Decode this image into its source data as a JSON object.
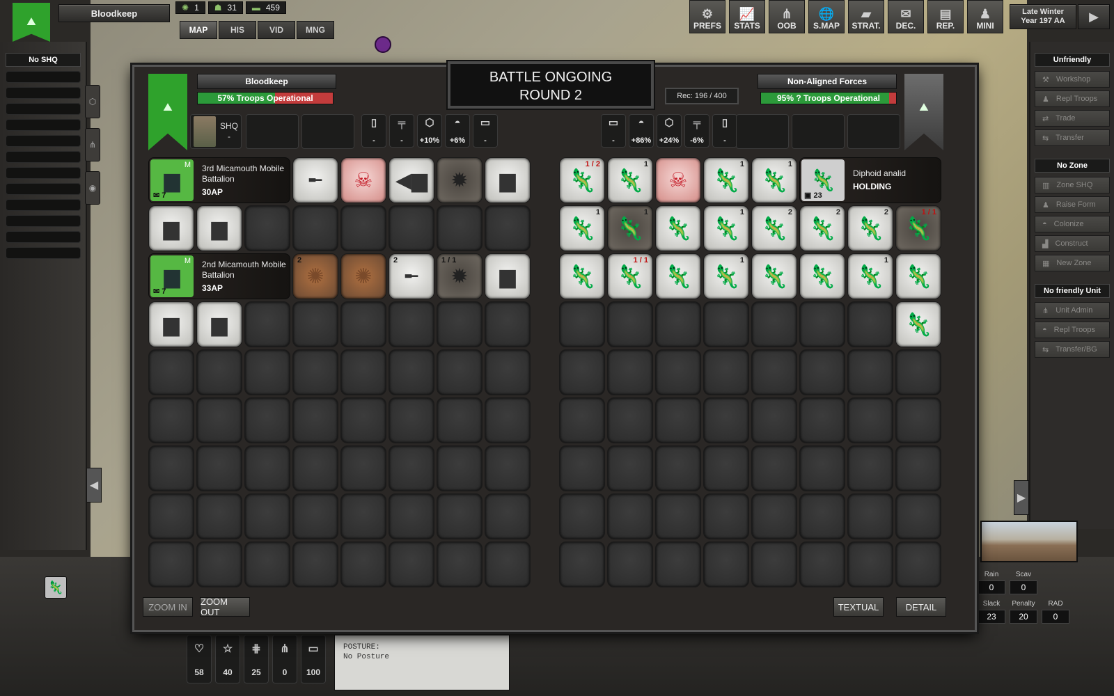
{
  "top": {
    "faction_name": "Bloodkeep",
    "resources": [
      {
        "icon": "sun-icon",
        "value": "1"
      },
      {
        "icon": "troops-icon",
        "value": "31"
      },
      {
        "icon": "money-icon",
        "value": "459"
      }
    ],
    "tabs": [
      "MAP",
      "HIS",
      "VID",
      "MNG"
    ],
    "buttons": [
      {
        "label": "PREFS",
        "icon": "⚙",
        "name": "prefs"
      },
      {
        "label": "STATS",
        "icon": "📈",
        "name": "stats"
      },
      {
        "label": "OOB",
        "icon": "⋔",
        "name": "oob"
      },
      {
        "label": "S.MAP",
        "icon": "🌐",
        "name": "smap"
      },
      {
        "label": "STRAT.",
        "icon": "▰",
        "name": "strat"
      },
      {
        "label": "DEC.",
        "icon": "✉",
        "name": "dec"
      },
      {
        "label": "REP.",
        "icon": "▤",
        "name": "rep"
      },
      {
        "label": "MINI",
        "icon": "♟",
        "name": "mini"
      }
    ],
    "season": "Late Winter",
    "year": "Year 197 AA"
  },
  "left_panel": {
    "header": "No SHQ"
  },
  "battle": {
    "title_line1": "BATTLE ONGOING",
    "title_line2": "ROUND 2",
    "rec": "Rec: 196 / 400",
    "player": {
      "name": "Bloodkeep",
      "operational": "57% Troops Operational",
      "operational_fraction": 0.57,
      "shq_label": "SHQ",
      "shq_value": "-",
      "stats": [
        {
          "icon": "▯",
          "name": "card-icon",
          "value": "-"
        },
        {
          "icon": "╤",
          "name": "pistol-icon",
          "value": "-"
        },
        {
          "icon": "⬡",
          "name": "hex-icon",
          "value": "+10%"
        },
        {
          "icon": "◓",
          "name": "helmet-icon",
          "value": "+6%"
        },
        {
          "icon": "▭",
          "name": "barrel-icon",
          "value": "-"
        }
      ],
      "units": [
        {
          "name_line1": "3rd Micamouth Mobile",
          "name_line2": "Battalion",
          "ap": "30AP",
          "badge": "7",
          "rank": "M"
        },
        {
          "name_line1": "2nd Micamouth Mobile",
          "name_line2": "Battalion",
          "ap": "33AP",
          "badge": "7",
          "rank": "M"
        }
      ]
    },
    "enemy": {
      "name": "Non-Aligned Forces",
      "operational": "95% ? Troops Operational",
      "operational_fraction": 0.95,
      "stats": [
        {
          "icon": "▭",
          "name": "barrel-icon",
          "value": "-"
        },
        {
          "icon": "◓",
          "name": "helmet-icon",
          "value": "+86%"
        },
        {
          "icon": "⬡",
          "name": "hex-icon",
          "value": "+24%"
        },
        {
          "icon": "╤",
          "name": "pistol-icon",
          "value": "-6%"
        },
        {
          "icon": "▯",
          "name": "card-icon",
          "value": "-"
        }
      ],
      "unit_name": "Diphoid analid",
      "unit_status": "HOLDING",
      "unit_count": "23"
    },
    "left_cells": [
      [
        "",
        "",
        "",
        "artillery",
        "kill",
        "apc",
        "smoke",
        "truck"
      ],
      [
        "truck",
        "truck",
        "",
        "",
        "",
        "",
        "",
        ""
      ],
      [
        "",
        "",
        "",
        "fire",
        "fire",
        "artillery",
        "smoke",
        "truck"
      ],
      [
        "truck",
        "truck",
        "",
        "",
        "",
        "",
        "",
        ""
      ]
    ],
    "left_counts": [
      [
        "",
        "",
        "",
        "",
        "",
        "",
        "",
        ""
      ],
      [
        "",
        "",
        "",
        "",
        "",
        "",
        "",
        ""
      ],
      [
        "",
        "",
        "",
        "2",
        "",
        "2",
        "1 / 1",
        ""
      ],
      [
        "",
        "",
        "",
        "",
        "",
        "",
        "",
        ""
      ]
    ],
    "right_cells": [
      [
        "creature",
        "creature",
        "kill",
        "creature",
        "creature",
        "",
        "",
        ""
      ],
      [
        "creature",
        "smoke",
        "creature",
        "creature",
        "creature",
        "creature",
        "creature",
        "smoke"
      ],
      [
        "creature",
        "creature",
        "creature",
        "creature",
        "creature",
        "creature",
        "creature",
        "creature"
      ],
      [
        "",
        "",
        "",
        "",
        "",
        "",
        "",
        "creature"
      ]
    ],
    "right_counts": [
      [
        "1 / 2",
        "1",
        "",
        "1",
        "1",
        "",
        "",
        ""
      ],
      [
        "1",
        "1",
        "",
        "1",
        "2",
        "2",
        "2",
        "1 / 1"
      ],
      [
        "",
        "1 / 1",
        "",
        "1",
        "",
        "",
        "1",
        ""
      ],
      [
        "",
        "",
        "",
        "",
        "",
        "",
        "",
        ""
      ]
    ],
    "buttons": {
      "zoom_in": "ZOOM IN",
      "zoom_out": "ZOOM OUT",
      "textual": "TEXTUAL",
      "detail": "DETAIL"
    }
  },
  "right_panel": {
    "stance": "Unfriendly",
    "zone_actions": [
      "Workshop",
      "Repl Troops",
      "Trade",
      "Transfer"
    ],
    "zone_header": "No Zone",
    "zone_buttons": [
      "Zone SHQ",
      "Raise Form",
      "Colonize",
      "Construct",
      "New Zone"
    ],
    "unit_header": "No friendly Unit",
    "unit_buttons": [
      "Unit Admin",
      "Repl Troops",
      "Transfer/BG"
    ]
  },
  "bottom": {
    "stats": [
      {
        "icon": "♡",
        "name": "heart-icon",
        "value": "58"
      },
      {
        "icon": "☆",
        "name": "star-icon",
        "value": "40"
      },
      {
        "icon": "⋕",
        "name": "wire-icon",
        "value": "25"
      },
      {
        "icon": "⋔",
        "name": "hierarchy-icon",
        "value": "0"
      },
      {
        "icon": "▭",
        "name": "barrel-icon",
        "value": "100"
      }
    ],
    "posture_label": "POSTURE:",
    "posture_value": "No Posture",
    "zone_stats": [
      {
        "label": "Rain",
        "value": "0"
      },
      {
        "label": "Scav",
        "value": "0"
      },
      {
        "label": "Slack",
        "value": "23"
      },
      {
        "label": "Penalty",
        "value": "20"
      },
      {
        "label": "RAD",
        "value": "0"
      }
    ]
  }
}
